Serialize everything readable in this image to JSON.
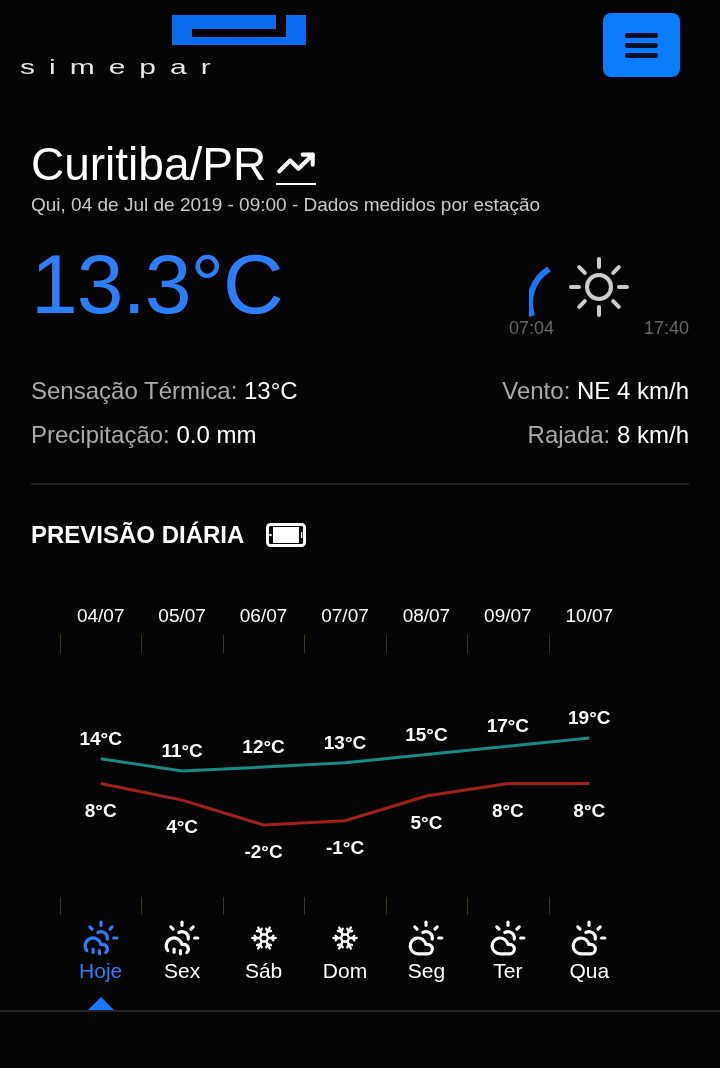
{
  "logo": {
    "text": "simepar"
  },
  "location": {
    "title": "Curitiba/PR",
    "subtitle": "Qui, 04 de Jul de 2019 - 09:00 - Dados medidos por estação"
  },
  "current": {
    "temperature": "13.3°C",
    "daylight": {
      "sunrise": "07:04",
      "sunset": "17:40"
    }
  },
  "details": [
    {
      "label": "Sensação Térmica:",
      "value": "13°C"
    },
    {
      "label": "Vento:",
      "value": "NE 4 km/h"
    },
    {
      "label": "Precipitação:",
      "value": "0.0 mm"
    },
    {
      "label": "Rajada:",
      "value": "8 km/h"
    }
  ],
  "forecast": {
    "title": "PREVISÃO DIÁRIA",
    "chart_data": {
      "type": "line",
      "categories": [
        "04/07",
        "05/07",
        "06/07",
        "07/07",
        "08/07",
        "09/07",
        "10/07"
      ],
      "series": [
        {
          "color": "#1a8a85",
          "values": [
            14,
            11,
            12,
            13,
            15,
            17,
            19
          ],
          "value_labels": [
            "14°C",
            "11°C",
            "12°C",
            "13°C",
            "15°C",
            "17°C",
            "19°C"
          ]
        },
        {
          "color": "#a3201a",
          "values": [
            8,
            4,
            -2,
            -1,
            5,
            8,
            8
          ],
          "value_labels": [
            "8°C",
            "4°C",
            "-2°C",
            "-1°C",
            "5°C",
            "8°C",
            "8°C"
          ]
        }
      ]
    },
    "days": [
      {
        "label": "Hoje",
        "kind": "rain",
        "selected": true
      },
      {
        "label": "Sex",
        "kind": "rain",
        "selected": false
      },
      {
        "label": "Sáb",
        "kind": "frost",
        "selected": false
      },
      {
        "label": "Dom",
        "kind": "frost",
        "selected": false
      },
      {
        "label": "Seg",
        "kind": "cloudy",
        "selected": false
      },
      {
        "label": "Ter",
        "kind": "cloudy",
        "selected": false
      },
      {
        "label": "Qua",
        "kind": "cloudy",
        "selected": false
      }
    ]
  }
}
